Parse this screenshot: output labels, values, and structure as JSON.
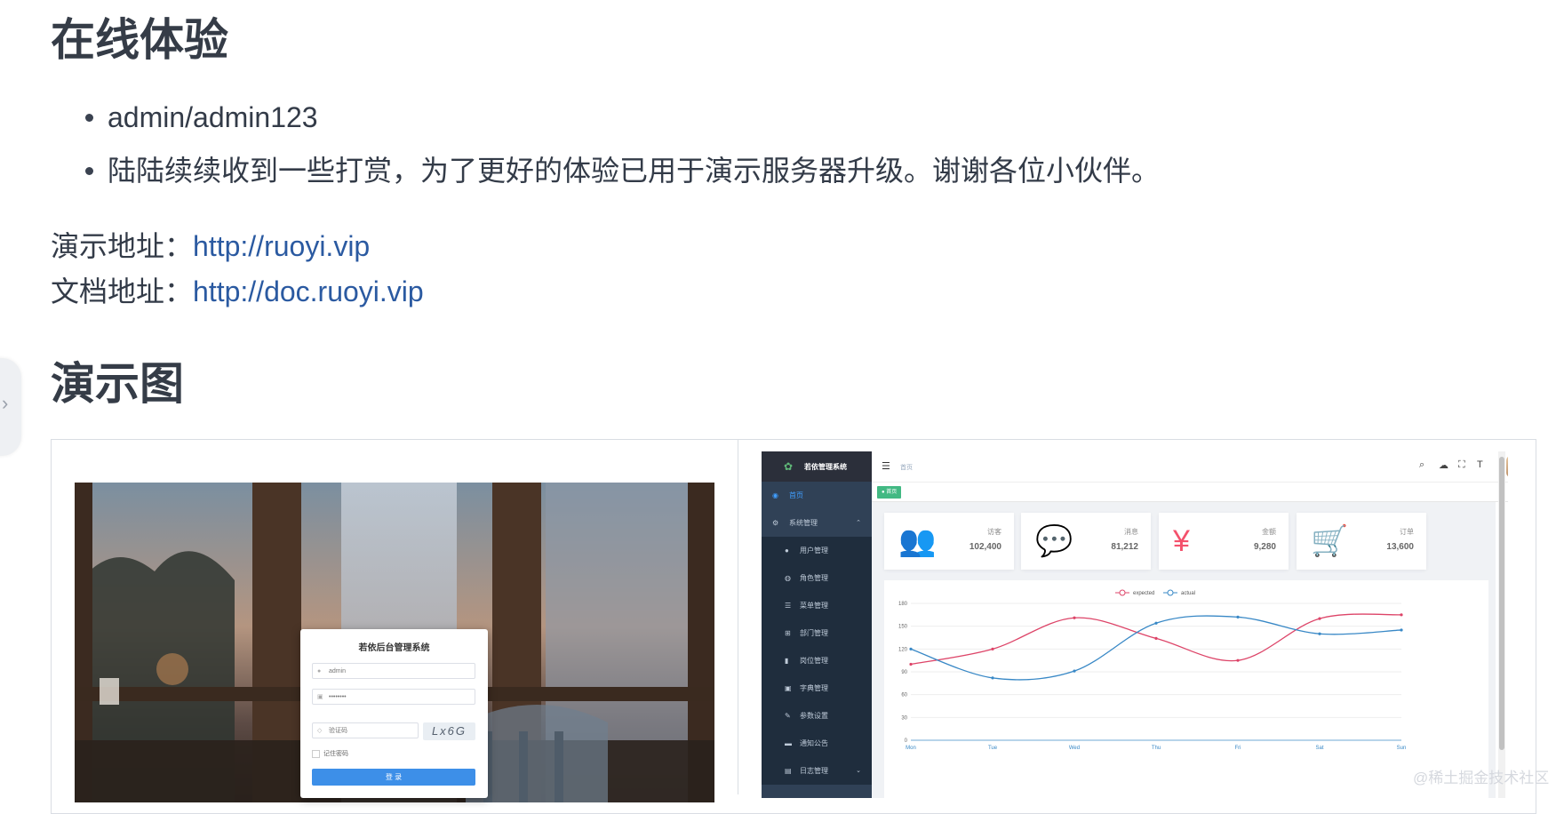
{
  "headings": {
    "online": "在线体验",
    "demo": "演示图"
  },
  "bullets": [
    "admin/admin123",
    "陆陆续续收到一些打赏，为了更好的体验已用于演示服务器升级。谢谢各位小伙伴。"
  ],
  "addresses": {
    "demo": {
      "label": "演示地址：",
      "link": "http://ruoyi.vip"
    },
    "doc": {
      "label": "文档地址：",
      "link": "http://doc.ruoyi.vip"
    }
  },
  "login": {
    "title": "若依后台管理系统",
    "username": "admin",
    "password": "••••••••",
    "captcha_placeholder": "验证码",
    "captcha_text": "Lx6G",
    "remember": "记住密码",
    "submit": "登 录"
  },
  "admin": {
    "system_name": "若依管理系统",
    "breadcrumb": "首页",
    "tag": "● 首页",
    "menu": [
      {
        "label": "首页",
        "icon": "dashboard-icon",
        "glyph": "◉",
        "level": "top",
        "active": true
      },
      {
        "label": "系统管理",
        "icon": "system-icon",
        "glyph": "⚙",
        "level": "top",
        "arrow": "⌃"
      },
      {
        "label": "用户管理",
        "icon": "user-icon",
        "glyph": "●",
        "level": "sub"
      },
      {
        "label": "角色管理",
        "icon": "role-icon",
        "glyph": "◍",
        "level": "sub"
      },
      {
        "label": "菜单管理",
        "icon": "menu-tree-icon",
        "glyph": "☰",
        "level": "sub"
      },
      {
        "label": "部门管理",
        "icon": "dept-icon",
        "glyph": "⊞",
        "level": "sub"
      },
      {
        "label": "岗位管理",
        "icon": "post-icon",
        "glyph": "▮",
        "level": "sub"
      },
      {
        "label": "字典管理",
        "icon": "dict-icon",
        "glyph": "▣",
        "level": "sub"
      },
      {
        "label": "参数设置",
        "icon": "edit-icon",
        "glyph": "✎",
        "level": "sub"
      },
      {
        "label": "通知公告",
        "icon": "message-icon",
        "glyph": "▬",
        "level": "sub"
      },
      {
        "label": "日志管理",
        "icon": "log-icon",
        "glyph": "▤",
        "level": "sub",
        "arrow": "⌄"
      }
    ],
    "panels": [
      {
        "label": "访客",
        "value": "102,400",
        "icon": "peoples-icon",
        "glyph": "👥",
        "color": "#40c9c6"
      },
      {
        "label": "消息",
        "value": "81,212",
        "icon": "message-bubble-icon",
        "glyph": "💬",
        "color": "#36a3f7"
      },
      {
        "label": "金额",
        "value": "9,280",
        "icon": "money-icon",
        "glyph": "¥",
        "color": "#f4516c"
      },
      {
        "label": "订单",
        "value": "13,600",
        "icon": "shopping-cart-icon",
        "glyph": "🛒",
        "color": "#34bfa3"
      }
    ]
  },
  "chart_data": {
    "type": "line",
    "x": [
      "Mon",
      "Tue",
      "Wed",
      "Thu",
      "Fri",
      "Sat",
      "Sun"
    ],
    "ylim": [
      0,
      180
    ],
    "yticks": [
      0,
      30,
      60,
      90,
      120,
      150,
      180
    ],
    "series": [
      {
        "name": "expected",
        "values": [
          100,
          120,
          161,
          134,
          105,
          160,
          165
        ],
        "color": "#dd4468"
      },
      {
        "name": "actual",
        "values": [
          120,
          82,
          91,
          154,
          162,
          140,
          145
        ],
        "color": "#3888c6"
      }
    ],
    "legend": "top-center"
  },
  "watermark": "@稀土掘金技术社区"
}
